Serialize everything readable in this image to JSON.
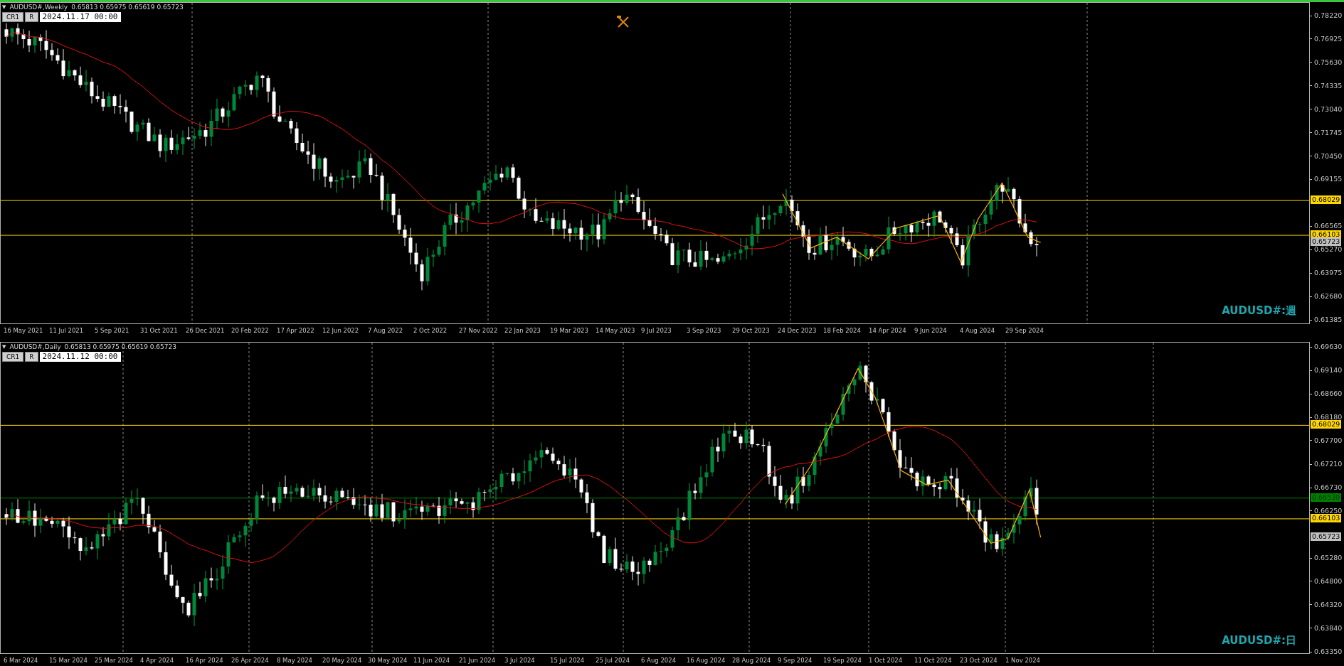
{
  "panels": [
    {
      "selected": true,
      "header": {
        "glyph": "▼",
        "symbol": "AUDUSD#,Weekly",
        "ohlc": "0.65813 0.65975 0.65619 0.65723"
      },
      "buttons": [
        "CR1",
        "R"
      ],
      "date_field": "2024.11.17 00:00",
      "label": "AUDUSD#:週",
      "price_ticks": [
        "0.78220",
        "0.76925",
        "0.75630",
        "0.74335",
        "0.73040",
        "0.71745",
        "0.70450",
        "0.69155",
        "0.66565",
        "0.65270",
        "0.63975",
        "0.62680",
        "0.61385"
      ],
      "price_tags": [
        {
          "label": "0.68029",
          "kind": "level",
          "color": "#ffd700"
        },
        {
          "label": "0.66103",
          "kind": "level",
          "color": "#ffd700"
        },
        {
          "label": "0.65723",
          "kind": "bid",
          "color": "#c0c0c0"
        }
      ],
      "time_labels": [
        "16 May 2021",
        "11 Jul 2021",
        "5 Sep 2021",
        "31 Oct 2021",
        "26 Dec 2021",
        "20 Feb 2022",
        "17 Apr 2022",
        "12 Jun 2022",
        "7 Aug 2022",
        "2 Oct 2022",
        "27 Nov 2022",
        "22 Jan 2023",
        "19 Mar 2023",
        "14 May 2023",
        "9 Jul 2023",
        "3 Sep 2023",
        "29 Oct 2023",
        "24 Dec 2023",
        "18 Feb 2024",
        "14 Apr 2024",
        "9 Jun 2024",
        "4 Aug 2024",
        "29 Sep 2024"
      ]
    },
    {
      "selected": false,
      "header": {
        "glyph": "▼",
        "symbol": "AUDUSD#,Daily",
        "ohlc": "0.65813 0.65975 0.65619 0.65723"
      },
      "buttons": [
        "CR1",
        "R"
      ],
      "date_field": "2024.11.12 00:00",
      "label": "AUDUSD#:日",
      "price_ticks": [
        "0.69630",
        "0.69140",
        "0.68660",
        "0.68180",
        "0.67700",
        "0.67210",
        "0.66730",
        "0.66250",
        "0.65280",
        "0.64800",
        "0.64320",
        "0.63840",
        "0.63350"
      ],
      "price_tags": [
        {
          "label": "0.68029",
          "kind": "level",
          "color": "#ffd700"
        },
        {
          "label": "0.66530",
          "kind": "alert",
          "color": "#008000"
        },
        {
          "label": "0.66103",
          "kind": "level",
          "color": "#ffd700"
        },
        {
          "label": "0.65723",
          "kind": "bid",
          "color": "#c0c0c0"
        }
      ],
      "time_labels": [
        "6 Mar 2024",
        "15 Mar 2024",
        "25 Mar 2024",
        "4 Apr 2024",
        "16 Apr 2024",
        "26 Apr 2024",
        "8 May 2024",
        "20 May 2024",
        "30 May 2024",
        "11 Jun 2024",
        "21 Jun 2024",
        "3 Jul 2024",
        "15 Jul 2024",
        "25 Jul 2024",
        "6 Aug 2024",
        "16 Aug 2024",
        "28 Aug 2024",
        "9 Sep 2024",
        "19 Sep 2024",
        "1 Oct 2024",
        "11 Oct 2024",
        "23 Oct 2024",
        "1 Nov 2024"
      ]
    }
  ]
}
